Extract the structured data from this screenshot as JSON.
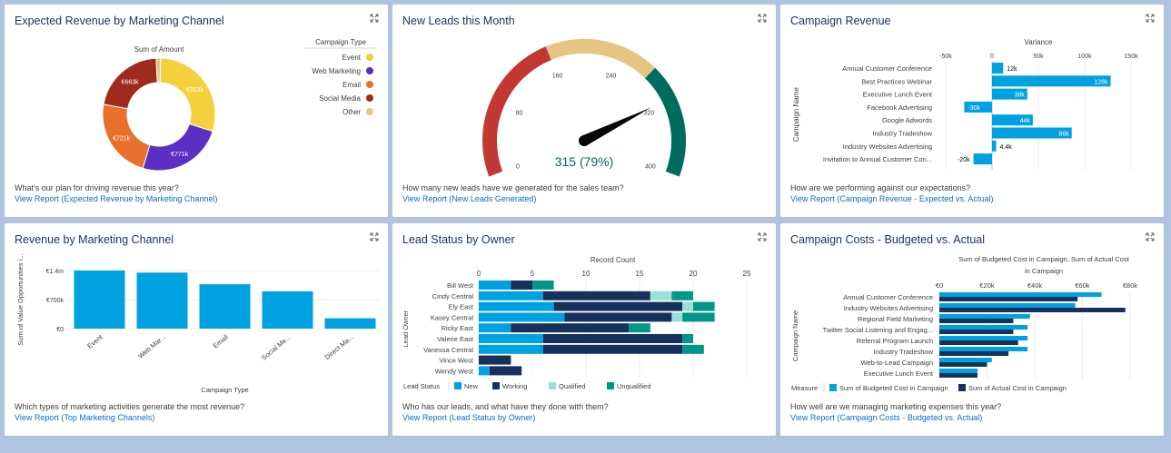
{
  "colors": {
    "accent": "#0070d2",
    "bar": "#00a1e0",
    "dark": "#16325c",
    "teal": "#9adfd8",
    "green": "#04844b"
  },
  "cards": {
    "expected_revenue": {
      "title": "Expected Revenue by Marketing Channel",
      "question": "What's our plan for driving revenue this year?",
      "link": "View Report (Expected Revenue by Marketing Channel)"
    },
    "new_leads": {
      "title": "New Leads this Month",
      "question": "How many new leads have we generated for the sales team?",
      "link": "View Report (New Leads Generated)"
    },
    "campaign_revenue": {
      "title": "Campaign Revenue",
      "question": "How are we performing against our expectations?",
      "link": "View Report (Campaign Revenue - Expected vs. Actual)"
    },
    "revenue_by_channel": {
      "title": "Revenue by Marketing Channel",
      "question": "Which types of marketing activities generate the most revenue?",
      "link": "View Report (Top Marketing Channels)"
    },
    "lead_status": {
      "title": "Lead Status by Owner",
      "question": "Who has our leads, and what have they done with them?",
      "link": "View Report (Lead Status by Owner)"
    },
    "campaign_costs": {
      "title": "Campaign Costs - Budgeted vs. Actual",
      "question": "How well are we managing marketing expenses this year?",
      "link": "View Report (Campaign Costs - Budgeted vs. Actual)"
    }
  },
  "chart_data": [
    {
      "type": "pie",
      "subtitle": "Sum of Amount",
      "legend_title": "Campaign Type",
      "legend_position": "right",
      "slices": [
        {
          "label": "Event",
          "value": 913,
          "display": "€913k",
          "color": "#f4d13c"
        },
        {
          "label": "Web Marketing",
          "value": 771,
          "display": "€771k",
          "color": "#5b2fc2"
        },
        {
          "label": "Email",
          "value": 721,
          "display": "€721k",
          "color": "#e7702a"
        },
        {
          "label": "Social Media",
          "value": 663,
          "display": "€663k",
          "color": "#9e2b1b"
        },
        {
          "label": "Other",
          "value": 40,
          "display": "",
          "color": "#e6c482"
        }
      ]
    },
    {
      "type": "gauge",
      "value": 315,
      "display": "315 (79%)",
      "range": [
        0,
        400
      ],
      "ticks": [
        0,
        80,
        160,
        240,
        320,
        400
      ],
      "bands": [
        {
          "from": 0,
          "to": 160,
          "color": "#c23934"
        },
        {
          "from": 160,
          "to": 280,
          "color": "#e6c482"
        },
        {
          "from": 280,
          "to": 400,
          "color": "#006b5f"
        }
      ]
    },
    {
      "type": "bar",
      "orientation": "horizontal",
      "xlabel": "Variance",
      "ylabel": "Campaign Name",
      "xlim": [
        -50,
        150
      ],
      "x_ticks": [
        "-50k",
        "0",
        "50k",
        "100k",
        "150k"
      ],
      "x_tick_values": [
        -50,
        0,
        50,
        100,
        150
      ],
      "categories": [
        "Annual Customer Conference",
        "Best Practices Webinar",
        "Executive Lunch Event",
        "Facebook Advertising",
        "Google Adwords",
        "Industry Tradeshow",
        "Industry Websites Advertising",
        "Invitation to Annual Customer Con..."
      ],
      "values": [
        12,
        128,
        38,
        -30,
        44,
        86,
        4.4,
        -20
      ],
      "labels": [
        "12k",
        "128k",
        "38k",
        "-30k",
        "44k",
        "86k",
        "4.4k",
        "-20k"
      ]
    },
    {
      "type": "bar",
      "xlabel": "Campaign Type",
      "ylabel": "Sum of Value Opportunities i...",
      "ylim": [
        0,
        1400
      ],
      "y_ticks": [
        "€1.4m",
        "€700k",
        "€0"
      ],
      "y_tick_values": [
        1400,
        700,
        0
      ],
      "categories": [
        "Event",
        "Web Mar...",
        "Email",
        "Social Me...",
        "Direct Ma..."
      ],
      "values": [
        1400,
        1350,
        1070,
        900,
        250
      ]
    },
    {
      "type": "bar",
      "orientation": "horizontal",
      "stacked": true,
      "xlabel": "Record Count",
      "ylabel": "Lead Owner",
      "xlim": [
        0,
        25
      ],
      "x_ticks": [
        "0",
        "5",
        "10",
        "15",
        "20",
        "25"
      ],
      "x_tick_values": [
        0,
        5,
        10,
        15,
        20,
        25
      ],
      "legend_title": "Lead Status",
      "legend_position": "bottom",
      "categories": [
        "Bill West",
        "Cindy Central",
        "Ely East",
        "Kasey Central",
        "Ricky East",
        "Valerie East",
        "Vanessa Central",
        "Vince West",
        "Wendy West"
      ],
      "series": [
        {
          "name": "New",
          "color": "#00a1e0",
          "values": [
            3,
            6,
            7,
            8,
            3,
            6,
            6,
            0,
            1
          ]
        },
        {
          "name": "Working",
          "color": "#16325c",
          "values": [
            2,
            10,
            12,
            10,
            11,
            13,
            13,
            3,
            3
          ]
        },
        {
          "name": "Qualified",
          "color": "#9adfd8",
          "values": [
            0,
            2,
            1,
            1,
            0,
            0,
            0,
            0,
            0
          ]
        },
        {
          "name": "Unqualified",
          "color": "#009688",
          "values": [
            2,
            2,
            2,
            3,
            2,
            1,
            2,
            0,
            0
          ]
        }
      ]
    },
    {
      "type": "bar",
      "orientation": "horizontal",
      "title": "Sum of Budgeted Cost in Campaign, Sum of Actual Cost in Campaign",
      "ylabel": "Campaign Name",
      "xlim": [
        0,
        80
      ],
      "x_ticks": [
        "€0",
        "€20k",
        "€40k",
        "€60k",
        "€80k"
      ],
      "x_tick_values": [
        0,
        20,
        40,
        60,
        80
      ],
      "legend_title": "Measure",
      "legend_position": "bottom",
      "categories": [
        "Annual Customer Conference",
        "Industry Websites Advertising",
        "Regional Field Marketing",
        "Twitter Social Listening and Engag...",
        "Referral Program Launch",
        "Industry Tradeshow",
        "Web-to-Lead Campaign",
        "Executive Lunch Event"
      ],
      "series": [
        {
          "name": "Sum of Budgeted Cost in Campaign",
          "color": "#00a1e0",
          "values": [
            68,
            57,
            38,
            37,
            37,
            37,
            22,
            16
          ]
        },
        {
          "name": "Sum of Actual Cost in Campaign",
          "color": "#16325c",
          "values": [
            58,
            78,
            31,
            31,
            33,
            29,
            20,
            16
          ]
        }
      ]
    }
  ]
}
